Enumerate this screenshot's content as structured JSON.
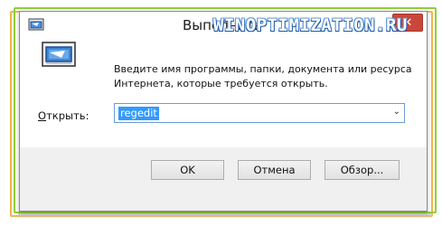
{
  "window": {
    "title": "Выполнить",
    "close_glyph": "✕"
  },
  "watermark": {
    "text": "WINOPTIMIZATION.RU"
  },
  "dialog": {
    "icon": "run-program-icon",
    "description": "Введите имя программы, папки, документа или ресурса Интернета, которые требуется открыть.",
    "open_label_accel": "О",
    "open_label_rest": "ткрыть:",
    "command_value": "regedit",
    "dropdown_glyph": "⌄"
  },
  "buttons": {
    "ok": "OK",
    "cancel": "Отмена",
    "browse": "Обзор..."
  },
  "colors": {
    "frame_orange": "#f0b44a",
    "frame_green": "#8fcf3a",
    "close_red": "#c9473a",
    "selection_blue": "#3399ff",
    "watermark_blue": "#1e5aa8"
  }
}
